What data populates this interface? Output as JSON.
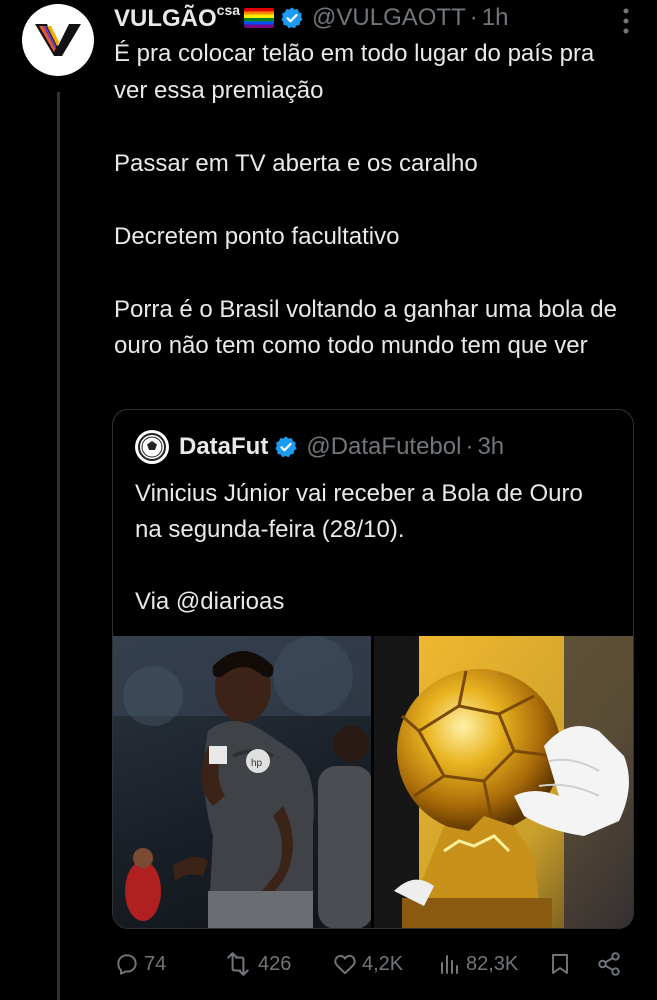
{
  "tweet": {
    "author": {
      "name": "VULGÃO",
      "name_suffix": "csa",
      "handle": "@VULGAOTT",
      "time": "1h"
    },
    "text_paragraphs": [
      "É pra colocar telão em todo lugar do país pra ver essa premiação",
      "Passar em TV aberta e os caralho",
      "Decretem ponto facultativo",
      "Porra é o Brasil voltando a ganhar uma bola de ouro não tem como todo mundo tem que ver"
    ],
    "actions": {
      "replies": "74",
      "retweets": "426",
      "likes": "4,2K",
      "views": "82,3K"
    }
  },
  "quote": {
    "author": {
      "name": "DataFut",
      "handle": "@DataFutebol",
      "time": "3h"
    },
    "text_paragraphs": [
      "Vinicius Júnior vai receber a Bola de Ouro na segunda-feira (28/10).",
      "Via @diarioas"
    ]
  },
  "icons": {
    "reply": "reply-icon",
    "retweet": "retweet-icon",
    "like": "heart-icon",
    "views": "views-icon",
    "bookmark": "bookmark-icon",
    "share": "share-icon",
    "more": "more-icon",
    "verified": "verified-badge-icon"
  },
  "colors": {
    "verified": "#1d9bf0",
    "muted": "#71767b",
    "text": "#e7e9ea",
    "background": "#000000"
  }
}
